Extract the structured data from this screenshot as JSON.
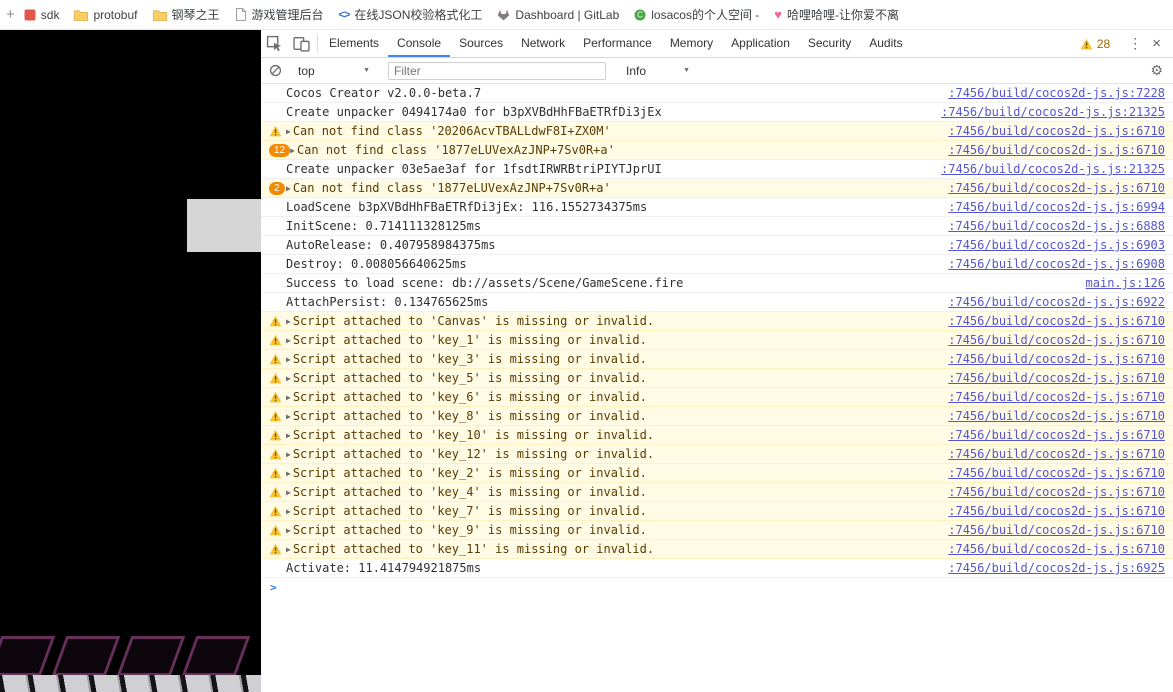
{
  "icons": {
    "plus": "+",
    "caret_down": "▼",
    "kebab": "⋮",
    "close": "×",
    "gear": "⚙",
    "expand": "▶",
    "prompt": ">"
  },
  "bookmarks": {
    "items": [
      {
        "label": "sdk",
        "icon": "red-app"
      },
      {
        "label": "protobuf",
        "icon": "folder"
      },
      {
        "label": "钢琴之王",
        "icon": "folder"
      },
      {
        "label": "游戏管理后台",
        "icon": "page"
      },
      {
        "label": "在线JSON校验格式化工",
        "icon": "code"
      },
      {
        "label": "Dashboard | GitLab",
        "icon": "gitlab"
      },
      {
        "label": "losacos的个人空间 -",
        "icon": "green-c"
      },
      {
        "label": "哈哩哈哩-让你爱不离",
        "icon": "heart"
      }
    ]
  },
  "devtools": {
    "tabs": [
      {
        "label": "Elements",
        "active": false
      },
      {
        "label": "Console",
        "active": true
      },
      {
        "label": "Sources",
        "active": false
      },
      {
        "label": "Network",
        "active": false
      },
      {
        "label": "Performance",
        "active": false
      },
      {
        "label": "Memory",
        "active": false
      },
      {
        "label": "Application",
        "active": false
      },
      {
        "label": "Security",
        "active": false
      },
      {
        "label": "Audits",
        "active": false
      }
    ],
    "warning_count": "28",
    "toolbar": {
      "context": "top",
      "filter_placeholder": "Filter",
      "level": "Info"
    },
    "console_rows": [
      {
        "type": "log",
        "text": "Cocos Creator v2.0.0-beta.7",
        "source": ":7456/build/cocos2d-js.js:7228"
      },
      {
        "type": "log",
        "text": "Create unpacker 0494174a0 for b3pXVBdHhFBaETRfDi3jEx",
        "source": ":7456/build/cocos2d-js.js:21325"
      },
      {
        "type": "warn",
        "expandable": true,
        "text": "Can not find class '20206AcvTBALLdwF8I+ZX0M'",
        "source": ":7456/build/cocos2d-js.js:6710"
      },
      {
        "type": "warn",
        "badge": "12",
        "expandable": true,
        "text": "Can not find class '1877eLUVexAzJNP+7Sv0R+a'",
        "source": ":7456/build/cocos2d-js.js:6710"
      },
      {
        "type": "log",
        "text": "Create unpacker 03e5ae3af for 1fsdtIRWRBtriPIYTJprUI",
        "source": ":7456/build/cocos2d-js.js:21325"
      },
      {
        "type": "warn",
        "badge": "2",
        "expandable": true,
        "text": "Can not find class '1877eLUVexAzJNP+7Sv0R+a'",
        "source": ":7456/build/cocos2d-js.js:6710"
      },
      {
        "type": "log",
        "text": "LoadScene b3pXVBdHhFBaETRfDi3jEx: 116.1552734375ms",
        "source": ":7456/build/cocos2d-js.js:6994"
      },
      {
        "type": "log",
        "text": "InitScene: 0.714111328125ms",
        "source": ":7456/build/cocos2d-js.js:6888"
      },
      {
        "type": "log",
        "text": "AutoRelease: 0.407958984375ms",
        "source": ":7456/build/cocos2d-js.js:6903"
      },
      {
        "type": "log",
        "text": "Destroy: 0.008056640625ms",
        "source": ":7456/build/cocos2d-js.js:6908"
      },
      {
        "type": "log",
        "text": "Success to load scene: db://assets/Scene/GameScene.fire",
        "source": "main.js:126"
      },
      {
        "type": "log",
        "text": "AttachPersist: 0.134765625ms",
        "source": ":7456/build/cocos2d-js.js:6922"
      },
      {
        "type": "warn",
        "expandable": true,
        "text": "Script attached to 'Canvas' is missing or invalid.",
        "source": ":7456/build/cocos2d-js.js:6710"
      },
      {
        "type": "warn",
        "expandable": true,
        "text": "Script attached to 'key_1' is missing or invalid.",
        "source": ":7456/build/cocos2d-js.js:6710"
      },
      {
        "type": "warn",
        "expandable": true,
        "text": "Script attached to 'key_3' is missing or invalid.",
        "source": ":7456/build/cocos2d-js.js:6710"
      },
      {
        "type": "warn",
        "expandable": true,
        "text": "Script attached to 'key_5' is missing or invalid.",
        "source": ":7456/build/cocos2d-js.js:6710"
      },
      {
        "type": "warn",
        "expandable": true,
        "text": "Script attached to 'key_6' is missing or invalid.",
        "source": ":7456/build/cocos2d-js.js:6710"
      },
      {
        "type": "warn",
        "expandable": true,
        "text": "Script attached to 'key_8' is missing or invalid.",
        "source": ":7456/build/cocos2d-js.js:6710"
      },
      {
        "type": "warn",
        "expandable": true,
        "text": "Script attached to 'key_10' is missing or invalid.",
        "source": ":7456/build/cocos2d-js.js:6710"
      },
      {
        "type": "warn",
        "expandable": true,
        "text": "Script attached to 'key_12' is missing or invalid.",
        "source": ":7456/build/cocos2d-js.js:6710"
      },
      {
        "type": "warn",
        "expandable": true,
        "text": "Script attached to 'key_2' is missing or invalid.",
        "source": ":7456/build/cocos2d-js.js:6710"
      },
      {
        "type": "warn",
        "expandable": true,
        "text": "Script attached to 'key_4' is missing or invalid.",
        "source": ":7456/build/cocos2d-js.js:6710"
      },
      {
        "type": "warn",
        "expandable": true,
        "text": "Script attached to 'key_7' is missing or invalid.",
        "source": ":7456/build/cocos2d-js.js:6710"
      },
      {
        "type": "warn",
        "expandable": true,
        "text": "Script attached to 'key_9' is missing or invalid.",
        "source": ":7456/build/cocos2d-js.js:6710"
      },
      {
        "type": "warn",
        "expandable": true,
        "text": "Script attached to 'key_11' is missing or invalid.",
        "source": ":7456/build/cocos2d-js.js:6710"
      },
      {
        "type": "log",
        "text": "Activate: 11.414794921875ms",
        "source": ":7456/build/cocos2d-js.js:6925"
      }
    ]
  }
}
